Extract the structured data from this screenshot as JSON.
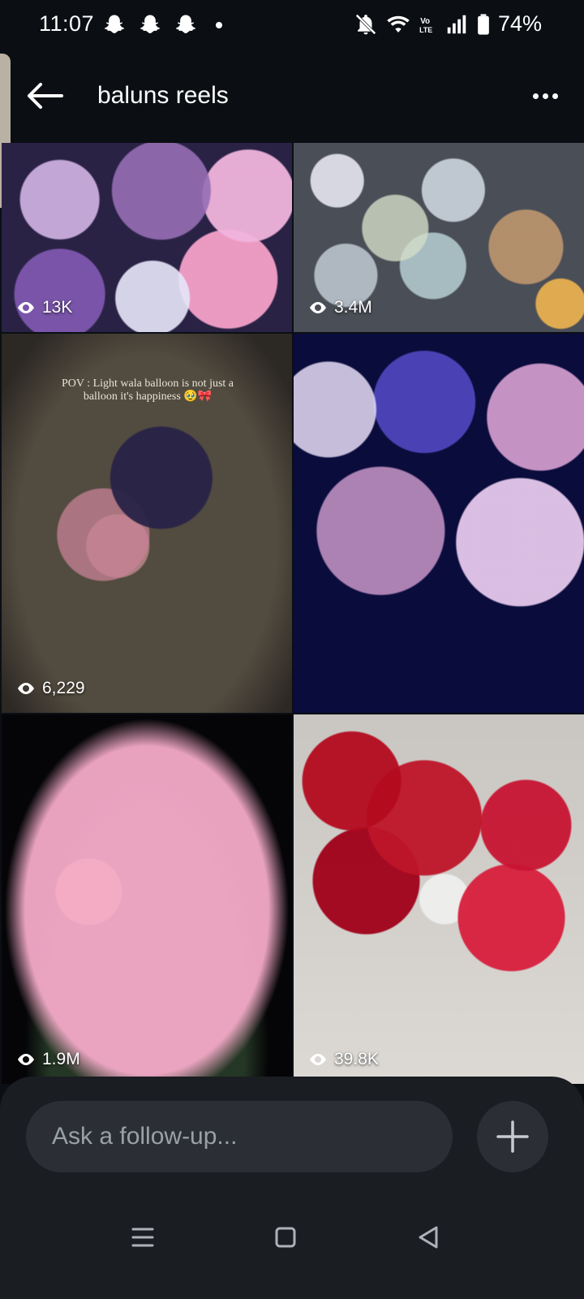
{
  "status_bar": {
    "time": "11:07",
    "battery": "74%",
    "notification_icons": [
      "snapchat-icon",
      "snapchat-icon",
      "snapchat-icon"
    ],
    "system_icons": [
      "mute-icon",
      "wifi-icon",
      "volte-icon",
      "signal-icon",
      "battery-icon"
    ]
  },
  "header": {
    "title": "baluns reels",
    "back_icon": "arrow-left-icon",
    "more_icon": "more-horizontal-icon"
  },
  "reels": [
    {
      "views": "13K"
    },
    {
      "views": "3.4M"
    },
    {
      "views": "6,229",
      "caption": "POV : Light wala balloon is not just a balloon it's happiness 🥹🎀"
    },
    {
      "views": ""
    },
    {
      "views": "1.9M"
    },
    {
      "views": "39.8K"
    }
  ],
  "follow_up": {
    "placeholder": "Ask a follow-up...",
    "add_icon": "plus-icon"
  },
  "nav_bar": {
    "items": [
      "recents-icon",
      "home-icon",
      "back-icon"
    ]
  },
  "colors": {
    "background": "#0b0f14",
    "sheet": "#1a1d22",
    "input": "#2b2f35",
    "handle": "#b9b1a3"
  }
}
